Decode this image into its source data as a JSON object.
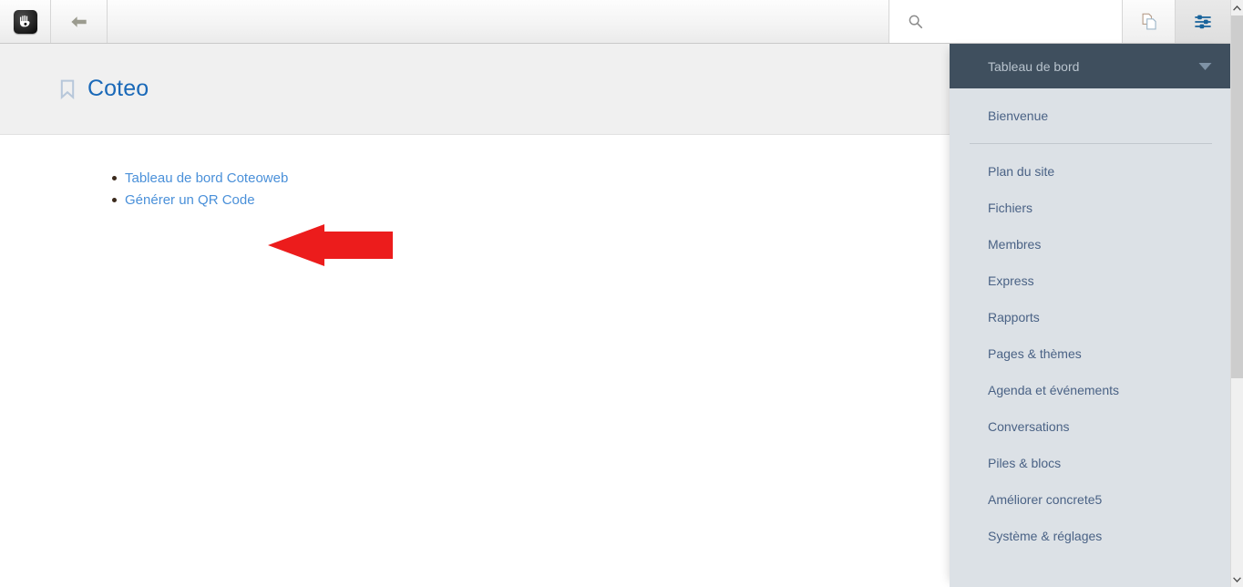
{
  "toolbar": {
    "logo_icon": "concrete5-hand-logo",
    "back_icon": "arrow-left-icon",
    "search": {
      "icon": "search-icon",
      "value": "",
      "placeholder": ""
    },
    "pages_icon": "copy-pages-icon",
    "settings_icon": "sliders-settings-icon"
  },
  "page": {
    "bookmark_icon": "bookmark-icon",
    "title": "Coteo",
    "links": [
      {
        "label": "Tableau de bord Coteoweb"
      },
      {
        "label": "Générer un QR Code"
      }
    ]
  },
  "annotation": {
    "shape": "arrow-left-annotation",
    "color": "#EC1C1C"
  },
  "panel": {
    "header": {
      "title": "Tableau de bord",
      "chevron_icon": "chevron-down-icon"
    },
    "items": [
      {
        "label": "Bienvenue",
        "divider_after": true
      },
      {
        "label": "Plan du site",
        "divider_after": false
      },
      {
        "label": "Fichiers",
        "divider_after": false
      },
      {
        "label": "Membres",
        "divider_after": false
      },
      {
        "label": "Express",
        "divider_after": false
      },
      {
        "label": "Rapports",
        "divider_after": false
      },
      {
        "label": "Pages & thèmes",
        "divider_after": false
      },
      {
        "label": "Agenda et événements",
        "divider_after": false
      },
      {
        "label": "Conversations",
        "divider_after": false
      },
      {
        "label": "Piles & blocs",
        "divider_after": false
      },
      {
        "label": "Améliorer concrete5",
        "divider_after": false
      },
      {
        "label": "Système & réglages",
        "divider_after": false
      }
    ]
  },
  "scrollbar": {
    "up_icon": "chevron-up-icon",
    "down_icon": "chevron-down-icon"
  },
  "colors": {
    "accent_blue": "#4a90d9",
    "title_blue": "#1a69b8",
    "panel_bg": "#dce1e6",
    "panel_header_bg": "#3f4f5e",
    "annotation_red": "#EC1C1C"
  }
}
